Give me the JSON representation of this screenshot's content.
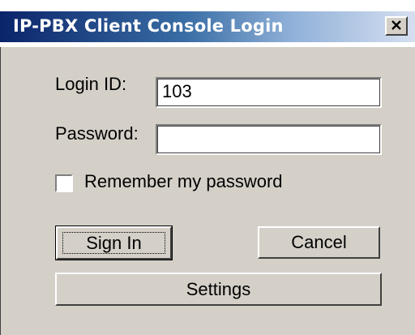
{
  "window": {
    "title": "IP-PBX Client Console Login",
    "close_label": "X"
  },
  "form": {
    "login_id_label": "Login ID:",
    "login_id_value": "103",
    "password_label": "Password:",
    "password_value": "",
    "remember_label": "Remember my password",
    "remember_checked": false
  },
  "buttons": {
    "sign_in": "Sign In",
    "cancel": "Cancel",
    "settings": "Settings"
  },
  "colors": {
    "title_start": "#0a246a",
    "title_end": "#d6dff0",
    "face": "#d4d0c8"
  }
}
